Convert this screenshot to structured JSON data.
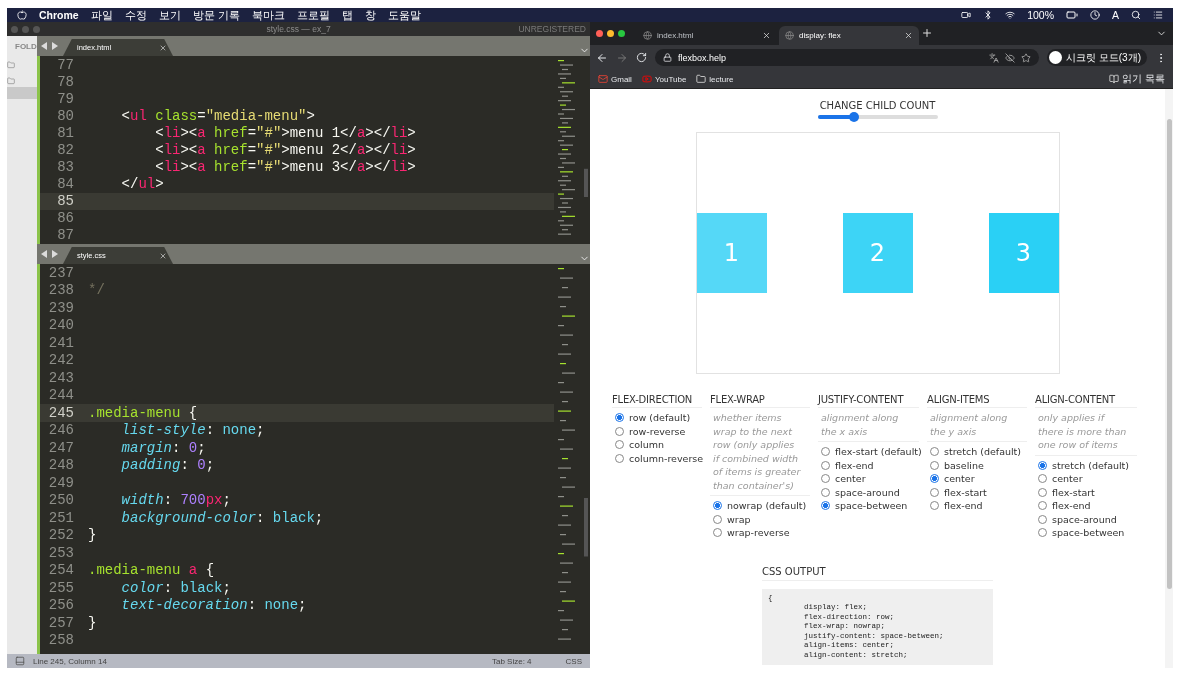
{
  "menubar": {
    "app": "Chrome",
    "menus": [
      "파일",
      "수정",
      "보기",
      "방문 기록",
      "북마크",
      "프로필",
      "탭",
      "창",
      "도움말"
    ],
    "battery": "100%",
    "input_source": "A"
  },
  "editor": {
    "title": "style.css — ex_7",
    "license": "UNREGISTERED",
    "sidebar_label": "FOLD",
    "panes": [
      {
        "tab": "index.html",
        "lines": [
          {
            "number": "77",
            "current": false
          },
          {
            "number": "78",
            "current": false
          },
          {
            "number": "79",
            "current": false
          },
          {
            "number": "80",
            "current": false,
            "code": "    <ul class=\"media-menu\">"
          },
          {
            "number": "81",
            "current": false,
            "code": "        <li><a href=\"#\">menu 1</a></li>"
          },
          {
            "number": "82",
            "current": false,
            "code": "        <li><a href=\"#\">menu 2</a></li>"
          },
          {
            "number": "83",
            "current": false,
            "code": "        <li><a href=\"#\">menu 3</a></li>"
          },
          {
            "number": "84",
            "current": false,
            "code": "    </ul>"
          },
          {
            "number": "85",
            "current": true
          },
          {
            "number": "86",
            "current": false
          },
          {
            "number": "87",
            "current": false
          }
        ]
      },
      {
        "tab": "style.css",
        "lines": [
          {
            "number": "237",
            "current": false
          },
          {
            "number": "238",
            "current": false,
            "code": "*/"
          },
          {
            "number": "239",
            "current": false
          },
          {
            "number": "240",
            "current": false
          },
          {
            "number": "241",
            "current": false
          },
          {
            "number": "242",
            "current": false
          },
          {
            "number": "243",
            "current": false
          },
          {
            "number": "244",
            "current": false
          },
          {
            "number": "245",
            "current": true,
            "code": ".media-menu {"
          },
          {
            "number": "246",
            "current": false,
            "code": "    list-style: none;"
          },
          {
            "number": "247",
            "current": false,
            "code": "    margin: 0;"
          },
          {
            "number": "248",
            "current": false,
            "code": "    padding: 0;"
          },
          {
            "number": "249",
            "current": false
          },
          {
            "number": "250",
            "current": false,
            "code": "    width: 700px;"
          },
          {
            "number": "251",
            "current": false,
            "code": "    background-color: black;"
          },
          {
            "number": "252",
            "current": false,
            "code": "}"
          },
          {
            "number": "253",
            "current": false
          },
          {
            "number": "254",
            "current": false,
            "code": ".media-menu a {"
          },
          {
            "number": "255",
            "current": false,
            "code": "    color: black;"
          },
          {
            "number": "256",
            "current": false,
            "code": "    text-decoration: none;"
          },
          {
            "number": "257",
            "current": false,
            "code": "}"
          },
          {
            "number": "258",
            "current": false
          }
        ]
      }
    ],
    "status_bar": {
      "position": "Line 245, Column 14",
      "tab_size": "Tab Size: 4",
      "syntax": "CSS"
    }
  },
  "browser": {
    "tabs": [
      {
        "title": "index.html",
        "selected": false
      },
      {
        "title": "display: flex",
        "selected": true
      }
    ],
    "url": "flexbox.help",
    "profile": "시크릿 모드(3개)",
    "bookmarks": [
      {
        "label": "Gmail",
        "kind": "gmail"
      },
      {
        "label": "YouTube",
        "kind": "youtube"
      },
      {
        "label": "lecture",
        "kind": "folder"
      }
    ],
    "reading_list": "읽기 목록",
    "page": {
      "child_count": {
        "label": "CHANGE CHILD COUNT",
        "level": 0.3
      },
      "items": [
        {
          "label": "1",
          "color": "#55d8f7"
        },
        {
          "label": "2",
          "color": "#3dd4f6"
        },
        {
          "label": "3",
          "color": "#2ad0f5"
        }
      ],
      "options": [
        {
          "title": "FLEX-DIRECTION",
          "options": [
            {
              "label": "row (default)",
              "selected": true
            },
            {
              "label": "row-reverse",
              "selected": false
            },
            {
              "label": "column",
              "selected": false
            },
            {
              "label": "column-reverse",
              "selected": false
            }
          ]
        },
        {
          "title": "FLEX-WRAP",
          "description": "whether items wrap to the next row (only applies if combined width of items is greater than container's)",
          "options": [
            {
              "label": "nowrap (default)",
              "selected": true
            },
            {
              "label": "wrap",
              "selected": false
            },
            {
              "label": "wrap-reverse",
              "selected": false
            }
          ]
        },
        {
          "title": "JUSTIFY-CONTENT",
          "description": "alignment along the x axis",
          "options": [
            {
              "label": "flex-start (default)",
              "selected": false
            },
            {
              "label": "flex-end",
              "selected": false
            },
            {
              "label": "center",
              "selected": false
            },
            {
              "label": "space-around",
              "selected": false
            },
            {
              "label": "space-between",
              "selected": true
            }
          ]
        },
        {
          "title": "ALIGN-ITEMS",
          "description": "alignment along the y axis",
          "options": [
            {
              "label": "stretch (default)",
              "selected": false
            },
            {
              "label": "baseline",
              "selected": false
            },
            {
              "label": "center",
              "selected": true
            },
            {
              "label": "flex-start",
              "selected": false
            },
            {
              "label": "flex-end",
              "selected": false
            }
          ]
        },
        {
          "title": "ALIGN-CONTENT",
          "description": "only applies if there is more than one row of items",
          "options": [
            {
              "label": "stretch (default)",
              "selected": true
            },
            {
              "label": "center",
              "selected": false
            },
            {
              "label": "flex-start",
              "selected": false
            },
            {
              "label": "flex-end",
              "selected": false
            },
            {
              "label": "space-around",
              "selected": false
            },
            {
              "label": "space-between",
              "selected": false
            }
          ]
        }
      ],
      "css_output": {
        "title": "CSS OUTPUT",
        "code": "{\n        display: flex;\n        flex-direction: row;\n        flex-wrap: nowrap;\n        justify-content: space-between;\n        align-items: center;\n        align-content: stretch;"
      }
    }
  }
}
